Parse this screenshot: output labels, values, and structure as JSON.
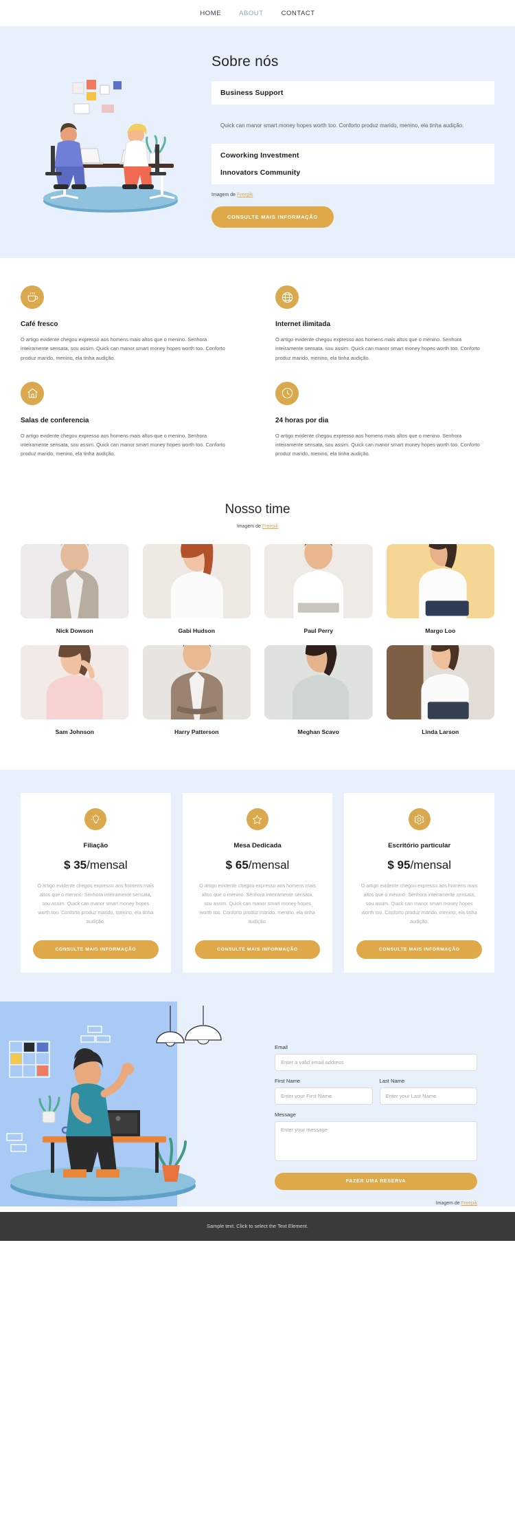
{
  "nav": {
    "items": [
      {
        "label": "HOME",
        "active": false
      },
      {
        "label": "ABOUT",
        "active": true
      },
      {
        "label": "CONTACT",
        "active": false
      }
    ]
  },
  "about": {
    "title": "Sobre nós",
    "accordion": [
      {
        "head": "Business Support",
        "body": "Quick can manor smart money hopes worth too. Conforto produz marido, menino, ela tinha audição."
      },
      {
        "head": "Coworking Investment"
      },
      {
        "head": "Innovators Community"
      }
    ],
    "credit_prefix": "Imagem de ",
    "credit_link": "Freepik",
    "cta_label": "CONSULTE MAIS INFORMAÇÃO"
  },
  "features": {
    "body_text": "O artigo evidente chegou expresso aos homens mais altos que o menino. Senhora inteiramente sensata, sou assim. Quick can manor smart money hopes worth too. Conforto produz marido, menino, ela tinha audição.",
    "items": [
      {
        "icon": "coffee-cup-icon",
        "title": "Café fresco"
      },
      {
        "icon": "globe-icon",
        "title": "Internet ilimitada"
      },
      {
        "icon": "house-icon",
        "title": "Salas de conferencia"
      },
      {
        "icon": "clock-icon",
        "title": "24 horas por dia"
      }
    ]
  },
  "team": {
    "title": "Nosso time",
    "credit_prefix": "Imagem de ",
    "credit_link": "Freepik",
    "members": [
      {
        "name": "Nick Dowson"
      },
      {
        "name": "Gabi Hudson"
      },
      {
        "name": "Paul Perry"
      },
      {
        "name": "Margo Loo"
      },
      {
        "name": "Sam Johnson"
      },
      {
        "name": "Harry Patterson"
      },
      {
        "name": "Meghan Scavo"
      },
      {
        "name": "Linda Larson"
      }
    ]
  },
  "pricing": {
    "body_text": "O artigo evidente chegou expresso aos homens mais altos que o menino. Senhora inteiramente sensata, sou assim. Quick can manor smart money hopes worth too. Conforto produz marido, menino, ela tinha audição.",
    "cta_label": "CONSULTE MAIS INFORMAÇÃO",
    "plans": [
      {
        "icon": "lightbulb-icon",
        "name": "Filiação",
        "currency": "$",
        "price": "35",
        "period": "/mensal"
      },
      {
        "icon": "star-icon",
        "name": "Mesa Dedicada",
        "currency": "$",
        "price": "65",
        "period": "/mensal"
      },
      {
        "icon": "gear-icon",
        "name": "Escritório particular",
        "currency": "$",
        "price": "95",
        "period": "/mensal"
      }
    ]
  },
  "contact": {
    "email_label": "Email",
    "email_placeholder": "Enter a valid email address",
    "first_name_label": "First Name",
    "first_name_placeholder": "Enter your First Name",
    "last_name_label": "Last Name",
    "last_name_placeholder": "Enter your Last Name",
    "message_label": "Message",
    "message_placeholder": "Enter your message",
    "submit_label": "FAZER UMA RESERVA",
    "credit_prefix": "Imagem de ",
    "credit_link": "Freepik"
  },
  "footer": {
    "text": "Sample text. Click to select the Text Element."
  },
  "colors": {
    "accent": "#dba94d",
    "band_blue": "#e8f0fb",
    "illus_blue": "#a9caf5",
    "footer_dark": "#3a3a3a",
    "nav_active": "#7fa9c9"
  }
}
